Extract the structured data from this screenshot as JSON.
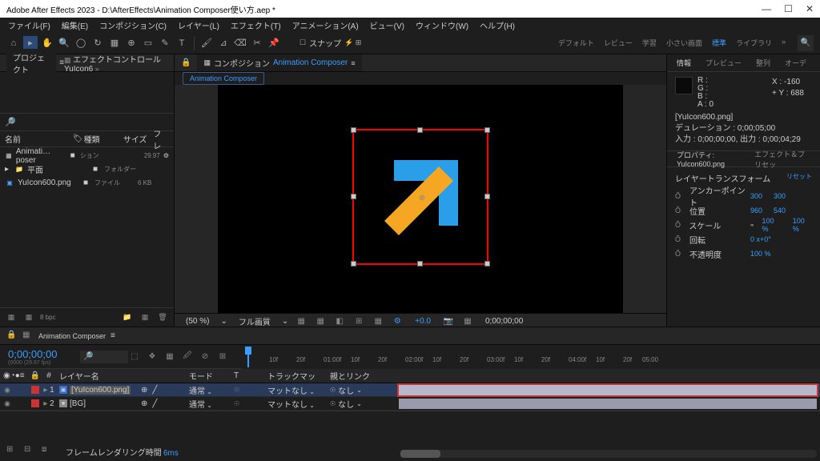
{
  "titlebar": {
    "title": "Adobe After Effects 2023 - D:\\AfterEffects\\Animation Composer使い方.aep *"
  },
  "menu": [
    "ファイル(F)",
    "編集(E)",
    "コンポジション(C)",
    "レイヤー(L)",
    "エフェクト(T)",
    "アニメーション(A)",
    "ビュー(V)",
    "ウィンドウ(W)",
    "ヘルプ(H)"
  ],
  "toolbar": {
    "snap": "スナップ",
    "workspaces": [
      "デフォルト",
      "レビュー",
      "学習",
      "小さい画面",
      "標準",
      "ライブラリ"
    ],
    "active_ws": "標準"
  },
  "project": {
    "tab": "プロジェクト",
    "fxtab": "エフェクトコントロール YuIcon6",
    "headers": {
      "name": "名前",
      "type": "種類",
      "size": "サイズ",
      "fr": "フレ"
    },
    "items": [
      {
        "name": "Animati…poser",
        "type": "ション",
        "size": "",
        "fr": "29.97",
        "icon": "comp",
        "color": "#888"
      },
      {
        "name": "平面",
        "type": "フォルダー",
        "size": "",
        "icon": "folder",
        "color": "#888"
      },
      {
        "name": "YuIcon600.png",
        "type": "ファイル",
        "size": "6 KB",
        "icon": "file",
        "color": "#4aa0ff"
      }
    ],
    "footer": {
      "bpc": "8 bpc"
    }
  },
  "comp": {
    "tabprefix": "コンポジション",
    "name": "Animation Composer",
    "subtab": "Animation Composer"
  },
  "viewfooter": {
    "zoom": "(50 %)",
    "quality": "フル画質",
    "exposure": "+0.0",
    "time": "0;00;00;00"
  },
  "info": {
    "tabs": [
      "情報",
      "プレビュー",
      "整列",
      "オーデ"
    ],
    "active": "情報",
    "rgb": {
      "r": "R :",
      "g": "G :",
      "b": "B :",
      "a": "A : 0"
    },
    "coords": {
      "x": "X : -160",
      "y": "Y : 688"
    },
    "src": "[YuIcon600.png]",
    "dur": "デュレーション : 0;00;05;00",
    "io": "入力 : 0;00;00;00, 出力 : 0;00;04;29"
  },
  "props": {
    "tab": "プロパティ: YuIcon600.png",
    "fxtab": "エフェクト＆プリセッ",
    "header": "レイヤートランスフォーム",
    "reset": "リセット",
    "rows": [
      {
        "sw": "Ŏ",
        "name": "アンカーポイント",
        "v1": "300",
        "v2": "300"
      },
      {
        "sw": "Ŏ",
        "name": "位置",
        "v1": "960",
        "v2": "540"
      },
      {
        "sw": "Ŏ",
        "name": "スケール",
        "link": "⚭",
        "v1": "100 %",
        "v2": "100 %"
      },
      {
        "sw": "Ŏ",
        "name": "回転",
        "v1": "0 x+0°"
      },
      {
        "sw": "Ŏ",
        "name": "不透明度",
        "v1": "100 %"
      }
    ]
  },
  "timeline": {
    "tab": "Animation Composer",
    "timecode": "0;00;00;00",
    "frames": "(0000 (29.97 fps)",
    "cols": {
      "eye": "◉◔●≡",
      "lock": "🔒",
      "num": "#",
      "name": "レイヤー名",
      "mode": "モード",
      "t": "T",
      "trkmat": "トラックマッ",
      "parent": "親とリンク"
    },
    "ticks": [
      "10f",
      "20f",
      "01:00f",
      "10f",
      "20f",
      "02:00f",
      "10f",
      "20f",
      "03:00f",
      "10f",
      "20f",
      "04:00f",
      "10f",
      "20f",
      "05:00"
    ],
    "layers": [
      {
        "num": "1",
        "color": "#cc3333",
        "name": "[YuIcon600.png]",
        "mode": "通常",
        "trkmat": "マットなし",
        "parent": "なし",
        "selected": true,
        "icon": "img"
      },
      {
        "num": "2",
        "color": "#cc3333",
        "name": "[BG]",
        "mode": "通常",
        "trkmat": "マットなし",
        "parent": "なし",
        "selected": false,
        "icon": "solid"
      }
    ],
    "footer": {
      "render": "フレームレンダリング時間",
      "ms": "6ms"
    }
  }
}
